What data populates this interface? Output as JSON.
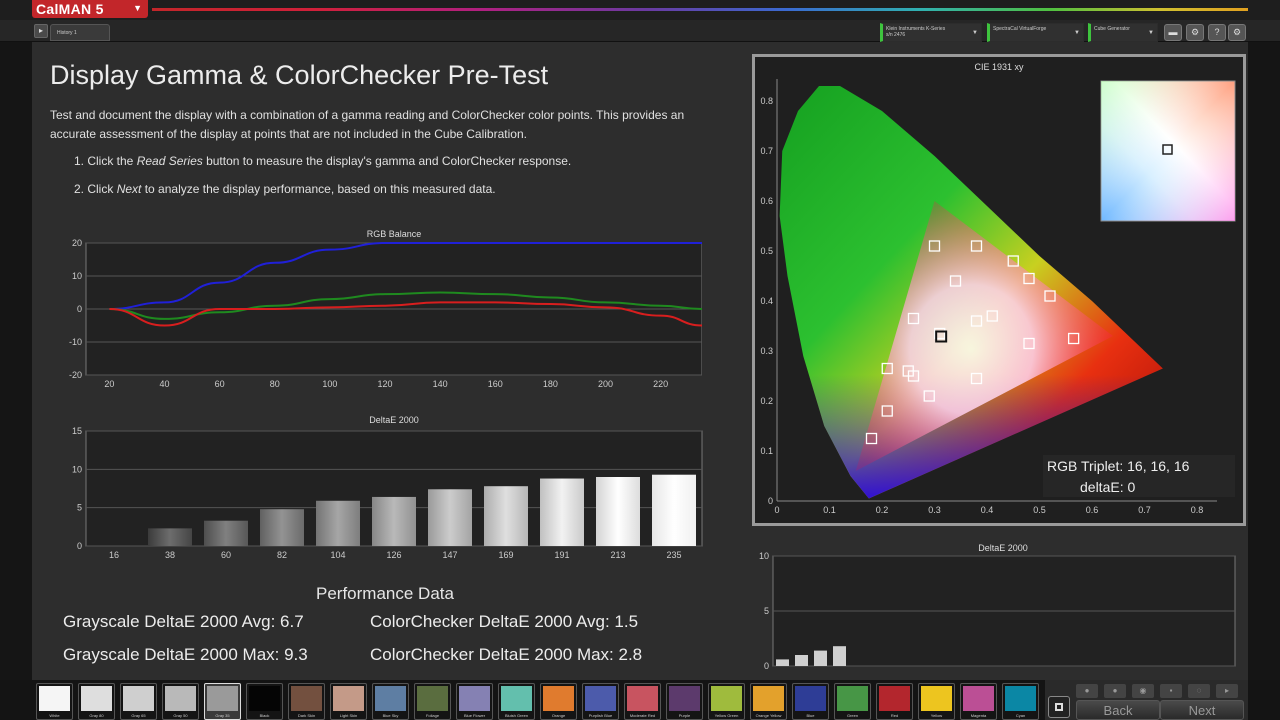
{
  "app": {
    "name": "CalMAN 5",
    "menu_caret": "▼"
  },
  "history_tab": "History 1",
  "devices": [
    {
      "line1": "Klein Instruments K-Series",
      "line2": "s/n 2476"
    },
    {
      "line1": "SpectraCal VirtualForge",
      "line2": ""
    },
    {
      "line1": "Cube Generator",
      "line2": ""
    }
  ],
  "page": {
    "title": "Display Gamma & ColorChecker Pre-Test",
    "description": "Test and document the display with a combination of a gamma reading and ColorChecker color points.  This provides an accurate assessment of the display at points that are not included in the Cube Calibration.",
    "step1": {
      "prefix": "1. Click the ",
      "em": "Read Series",
      "suffix": " button to measure the display's gamma and ColorChecker response."
    },
    "step2": {
      "prefix": "2. Click ",
      "em": "Next",
      "suffix": " to analyze the display performance, based on this measured data."
    }
  },
  "chart_data": [
    {
      "type": "line",
      "title": "RGB Balance",
      "x": [
        20,
        40,
        60,
        80,
        100,
        120,
        140,
        160,
        180,
        200,
        220,
        235
      ],
      "xticks": [
        20,
        40,
        60,
        80,
        100,
        120,
        140,
        160,
        180,
        200,
        220
      ],
      "yticks": [
        20,
        10,
        0,
        -10,
        -20
      ],
      "ylim": [
        -20,
        20
      ],
      "series": [
        {
          "color": "#2020d8",
          "values": [
            0,
            2,
            8,
            14,
            18,
            20,
            20,
            20,
            20,
            20,
            20,
            20
          ]
        },
        {
          "color": "#1f8a1f",
          "values": [
            0,
            -3,
            -1,
            1,
            3,
            4.5,
            5,
            4.5,
            3.5,
            2,
            1,
            0
          ]
        },
        {
          "color": "#d81e1e",
          "values": [
            0,
            -5,
            0,
            0,
            0.5,
            1,
            2,
            2,
            1.5,
            0.5,
            -2,
            -5
          ]
        }
      ]
    },
    {
      "type": "bar",
      "title": "DeltaE 2000",
      "categories": [
        "16",
        "38",
        "60",
        "82",
        "104",
        "126",
        "147",
        "169",
        "191",
        "213",
        "235"
      ],
      "values": [
        0,
        2.3,
        3.3,
        4.8,
        5.9,
        6.4,
        7.4,
        7.8,
        8.8,
        9.0,
        9.3
      ],
      "ylim": [
        0,
        15
      ],
      "yticks": [
        15,
        10,
        5,
        0
      ]
    },
    {
      "type": "scatter",
      "title": "CIE 1931 xy",
      "xlim": [
        0,
        0.85
      ],
      "ylim": [
        0,
        0.85
      ],
      "xticks": [
        "0",
        "0.1",
        "0.2",
        "0.3",
        "0.4",
        "0.5",
        "0.6",
        "0.7",
        "0.8"
      ],
      "yticks": [
        "0.8",
        "0.7",
        "0.6",
        "0.5",
        "0.4",
        "0.3",
        "0.2",
        "0.1",
        "0"
      ],
      "gamut_triangle": [
        [
          0.64,
          0.33
        ],
        [
          0.3,
          0.6
        ],
        [
          0.15,
          0.06
        ]
      ],
      "points": [
        [
          0.3,
          0.51
        ],
        [
          0.38,
          0.51
        ],
        [
          0.45,
          0.48
        ],
        [
          0.34,
          0.44
        ],
        [
          0.48,
          0.445
        ],
        [
          0.52,
          0.41
        ],
        [
          0.26,
          0.365
        ],
        [
          0.38,
          0.36
        ],
        [
          0.41,
          0.37
        ],
        [
          0.31,
          0.335
        ],
        [
          0.565,
          0.325
        ],
        [
          0.48,
          0.315
        ],
        [
          0.21,
          0.265
        ],
        [
          0.25,
          0.26
        ],
        [
          0.26,
          0.25
        ],
        [
          0.38,
          0.245
        ],
        [
          0.29,
          0.21
        ],
        [
          0.21,
          0.18
        ],
        [
          0.18,
          0.125
        ]
      ],
      "white_point": [
        0.3127,
        0.329
      ],
      "readout": {
        "line1": "RGB Triplet: 16, 16, 16",
        "line2": "deltaE: 0"
      }
    },
    {
      "type": "bar",
      "title": "DeltaE 2000",
      "values": [
        0.6,
        1.0,
        1.4,
        1.8
      ],
      "ylim": [
        0,
        10
      ],
      "yticks": [
        10,
        5,
        0
      ]
    }
  ],
  "performance": {
    "title": "Performance Data",
    "gray_avg": "Grayscale DeltaE 2000 Avg:  6.7",
    "gray_max": "Grayscale DeltaE 2000 Max: 9.3",
    "cc_avg": "ColorChecker DeltaE 2000 Avg:  1.5",
    "cc_max": "ColorChecker DeltaE 2000 Max: 2.8"
  },
  "palette": [
    {
      "label": "White",
      "color": "#f5f5f5"
    },
    {
      "label": "Gray 80",
      "color": "#dedede"
    },
    {
      "label": "Gray 65",
      "color": "#cfcfcf"
    },
    {
      "label": "Gray 50",
      "color": "#b9b9b9"
    },
    {
      "label": "Gray 35",
      "color": "#9a9a9a",
      "selected": true
    },
    {
      "label": "Black",
      "color": "#050505"
    },
    {
      "label": "Dark Skin",
      "color": "#73503f"
    },
    {
      "label": "Light Skin",
      "color": "#c49a88"
    },
    {
      "label": "Blue Sky",
      "color": "#5e7ea3"
    },
    {
      "label": "Foliage",
      "color": "#5a6d3f"
    },
    {
      "label": "Blue Flower",
      "color": "#8581b3"
    },
    {
      "label": "Bluish Green",
      "color": "#63bfad"
    },
    {
      "label": "Orange",
      "color": "#e07b2e"
    },
    {
      "label": "Purplish Blue",
      "color": "#4c5bab"
    },
    {
      "label": "Moderate Red",
      "color": "#c85460"
    },
    {
      "label": "Purple",
      "color": "#5c3a6c"
    },
    {
      "label": "Yellow Green",
      "color": "#9fbb3d"
    },
    {
      "label": "Orange Yellow",
      "color": "#e3a12c"
    },
    {
      "label": "Blue",
      "color": "#2e3d96"
    },
    {
      "label": "Green",
      "color": "#479646"
    },
    {
      "label": "Red",
      "color": "#b3262d"
    },
    {
      "label": "Yellow",
      "color": "#edc51f"
    },
    {
      "label": "Magenta",
      "color": "#bb4f95"
    },
    {
      "label": "Cyan",
      "color": "#0b87a5"
    }
  ],
  "nav": {
    "back": "Back",
    "next": "Next"
  }
}
